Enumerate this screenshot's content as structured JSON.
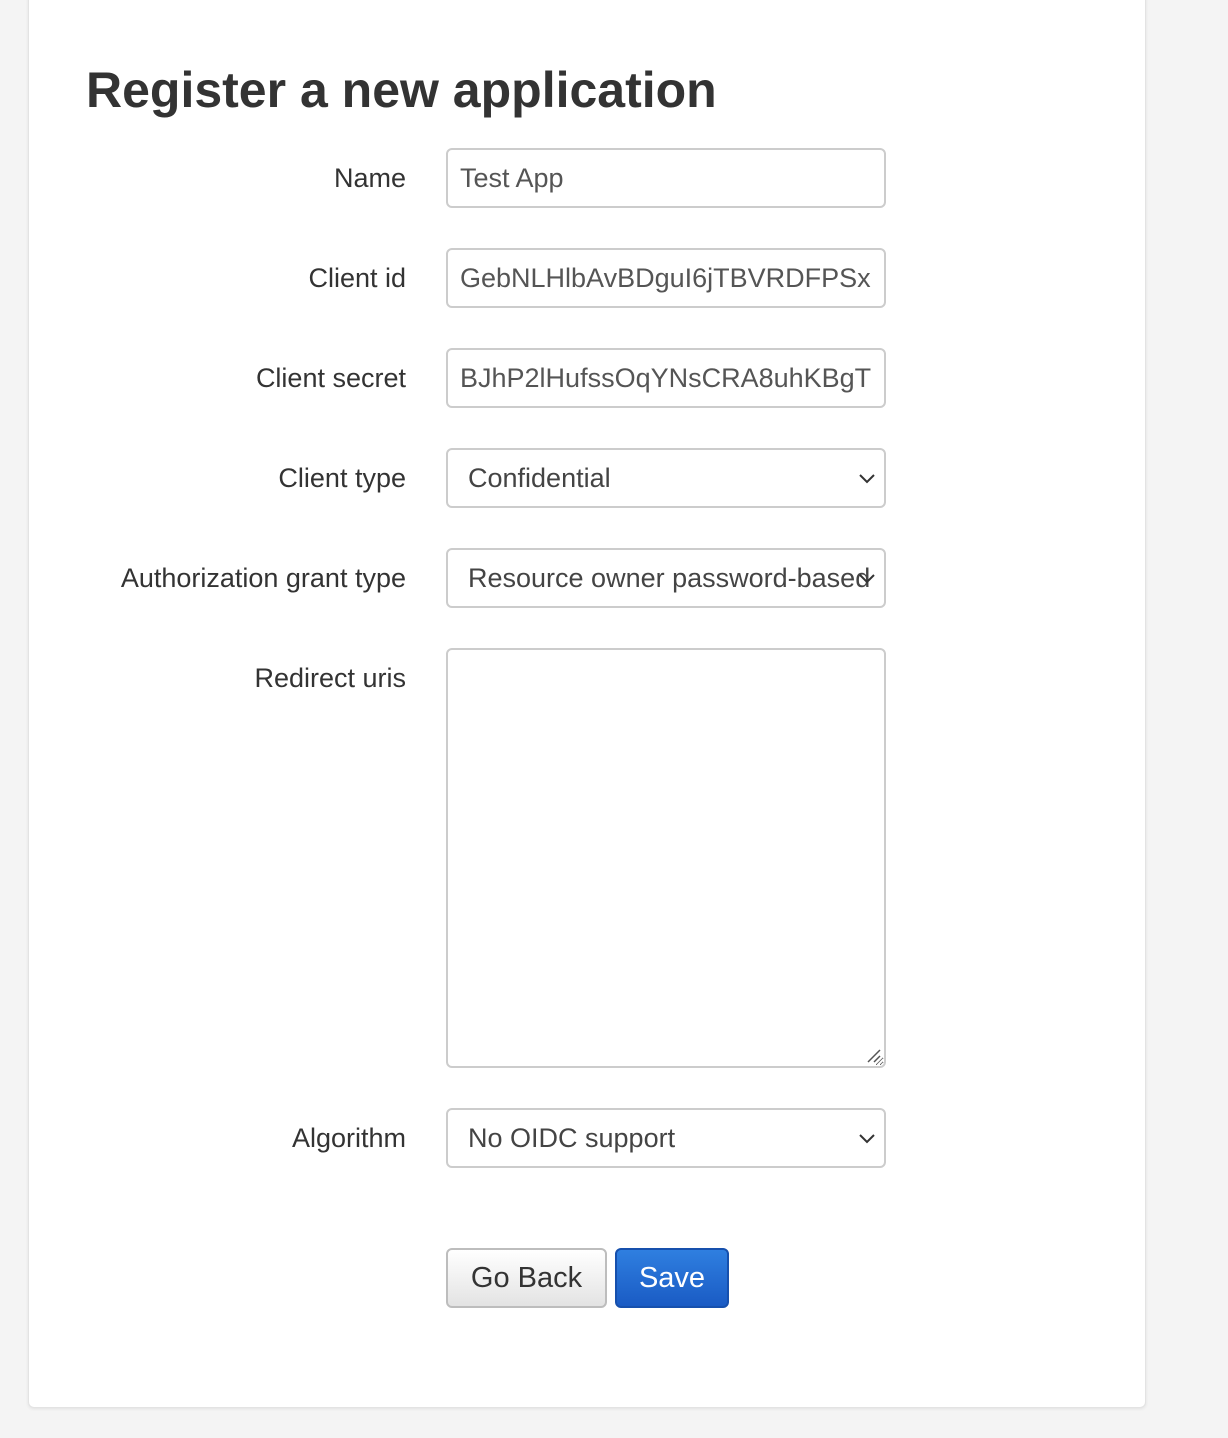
{
  "page": {
    "title": "Register a new application"
  },
  "form": {
    "name": {
      "label": "Name",
      "value": "Test App"
    },
    "client_id": {
      "label": "Client id",
      "value": "GebNLHlbAvBDguI6jTBVRDFPSx"
    },
    "client_secret": {
      "label": "Client secret",
      "value": "BJhP2lHufssOqYNsCRA8uhKBgT"
    },
    "client_type": {
      "label": "Client type",
      "selected": "Confidential"
    },
    "grant_type": {
      "label": "Authorization grant type",
      "selected": "Resource owner password-based"
    },
    "redirect_uris": {
      "label": "Redirect uris",
      "value": ""
    },
    "algorithm": {
      "label": "Algorithm",
      "selected": "No OIDC support"
    }
  },
  "buttons": {
    "go_back": "Go Back",
    "save": "Save"
  },
  "colors": {
    "primary": "#1a5bc4",
    "background": "#f4f4f4",
    "card": "#ffffff",
    "border": "#cccccc"
  },
  "icons": {
    "select_arrow": "chevron-down-icon",
    "textarea_resize": "resize-handle-icon"
  }
}
